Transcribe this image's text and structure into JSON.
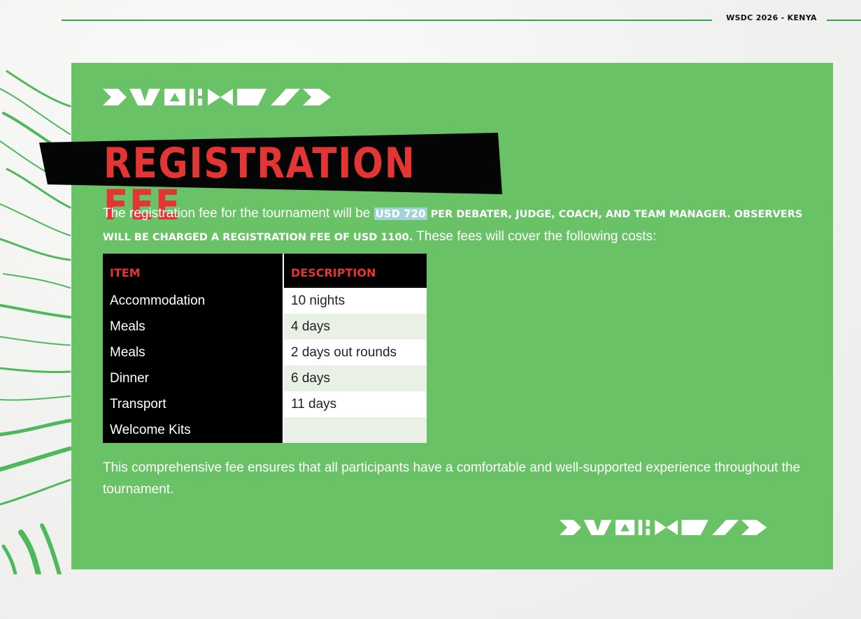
{
  "header": {
    "tag": "WSDC 2026 - KENYA",
    "accent_color": "#3aa04b"
  },
  "panel_color": "#6ac267",
  "title": "REGISTRATION FEE",
  "title_color": "#e43535",
  "intro": {
    "before": "The registration fee for the tournament will be ",
    "highlight": "USD 720",
    "caps": " per debater, judge, coach, and team manager. Observers will be charged a registration fee of USD 1100.",
    "after": " These fees will cover the following costs:"
  },
  "table": {
    "headers": [
      "ITEM",
      "DESCRIPTION"
    ],
    "rows": [
      {
        "item": "Accommodation",
        "description": "10 nights"
      },
      {
        "item": "Meals",
        "description": "4 days"
      },
      {
        "item": "Meals",
        "description": "2 days out rounds"
      },
      {
        "item": "Dinner",
        "description": "6 days"
      },
      {
        "item": "Transport",
        "description": "11 days"
      },
      {
        "item": "Welcome Kits",
        "description": ""
      }
    ]
  },
  "closing": "This comprehensive fee ensures that all participants have a comfortable and well-supported experience throughout the tournament.",
  "decorations": [
    "pattern-motif-top",
    "pattern-motif-bottom",
    "green-brush-texture"
  ]
}
